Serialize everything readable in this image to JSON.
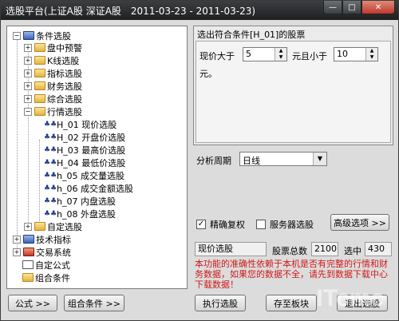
{
  "window": {
    "title": "选股平台(上证A股 深证A股　2011-03-23 - 2011-03-23)",
    "min_glyph": "—",
    "max_glyph": "□",
    "close_glyph": "✕"
  },
  "tree": {
    "root": "条件选股",
    "groups": [
      "盘中预警",
      "K线选股",
      "指标选股",
      "财务选股",
      "综合选股",
      "行情选股"
    ],
    "leaves": [
      "H_01 现价选股",
      "H_02 开盘价选股",
      "H_03 最高价选股",
      "H_04 最低价选股",
      "h_05 成交量选股",
      "h_06 成交金额选股",
      "h_07 内盘选股",
      "h_08 外盘选股"
    ],
    "after_group": "自定选股",
    "others": [
      "技术指标",
      "交易系统",
      "自定公式",
      "组合条件"
    ],
    "leaf_icon": "♣♣"
  },
  "condition": {
    "title": "选出符合条件[H_01]的股票",
    "price_gt_label": "现价大于",
    "price_gt_value": "5",
    "and_lt_label": "元且小于",
    "and_lt_value": "10",
    "unit": "元。"
  },
  "period": {
    "label": "分析周期",
    "value": "日线"
  },
  "options": {
    "precise_label": "精确复权",
    "precise_checked": "✓",
    "server_label": "服务器选股",
    "advanced_label": "高级选项 >>"
  },
  "status": {
    "selected_name": "现价选股",
    "total_label": "股票总数",
    "total_value": "2100",
    "chosen_label": "选中",
    "chosen_value": "430"
  },
  "warning": "本功能的准确性依赖于本机是否有完整的行情和财务数据，如果您的数据不全，请先到数据下载中心下载数据！",
  "buttons": {
    "formula": "公式 >>",
    "combo": "组合条件 >>",
    "run": "执行选股",
    "save": "存至板块",
    "exit": "退出选股"
  },
  "watermark": "ITcmc"
}
